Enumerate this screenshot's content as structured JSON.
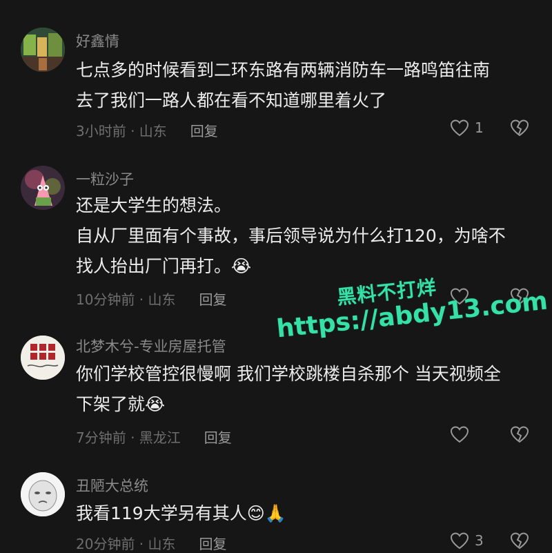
{
  "colors": {
    "background": "#161616",
    "username": "#8a8a8a",
    "text": "#ececec",
    "meta": "#6f6f6f",
    "watermark": "#36e0a6"
  },
  "comments": [
    {
      "username": "好鑫情",
      "lines": [
        "七点多的时候看到二环东路有两辆消防车一路鸣笛往南",
        "去了我们一路人都在看不知道哪里着火了"
      ],
      "meta": "3小时前 · 山东",
      "reply": "回复",
      "likes": "1",
      "icons": [
        "heart-outline-icon",
        "broken-heart-icon"
      ]
    },
    {
      "username": "一粒沙子",
      "lines": [
        "还是大学生的想法。",
        "自从厂里面有个事故，事后领导说为什么打120，为啥不",
        "找人抬出厂门再打。😭"
      ],
      "meta": "10分钟前 · 山东",
      "reply": "回复",
      "likes": "",
      "icons": [
        "heart-outline-icon",
        "broken-heart-icon"
      ]
    },
    {
      "username": "北梦木兮-专业房屋托管",
      "lines": [
        "你们学校管控很慢啊 我们学校跳楼自杀那个 当天视频全",
        "下架了就😭"
      ],
      "meta": "7分钟前 · 黑龙江",
      "reply": "回复",
      "likes": "",
      "icons": [
        "heart-outline-icon",
        "broken-heart-icon"
      ]
    },
    {
      "username": "丑陋大总统",
      "lines": [
        "我看119大学另有其人😊🙏"
      ],
      "meta": "20分钟前 · 山东",
      "reply": "回复",
      "likes": "3",
      "icons": [
        "heart-outline-icon",
        "broken-heart-icon"
      ]
    }
  ],
  "watermark": {
    "line1": "黑料不打烊",
    "line2": "https://abdy13.com"
  }
}
